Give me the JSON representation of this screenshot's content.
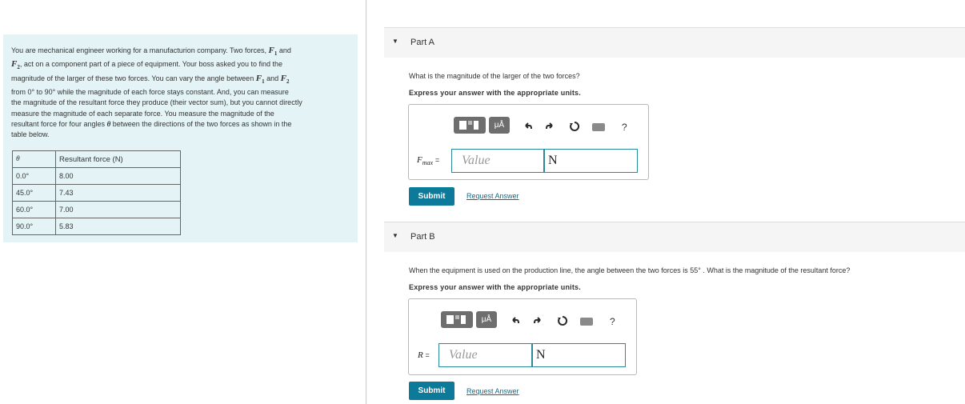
{
  "problem": {
    "line1_a": "You are mechanical engineer working for a manufacturion company. Two forces,",
    "line1_b": "and",
    "f1": "F",
    "f1_sub": "1",
    "f2": "F",
    "f2_sub": "2",
    "line2": ", act on a component part of a piece of equipment. Your boss asked you to find the",
    "line3_a": "magnitude of the larger of these two forces. You can vary the angle between",
    "line3_b": "and",
    "line4": "from 0° to 90° while the magnitude of each force stays constant. And, you can measure",
    "line5": "the magnitude of the resultant force they produce (their vector sum), but you cannot directly",
    "line6": "measure the magnitude of each separate force. You measure the magnitude of the",
    "line7_a": "resultant force for four angles",
    "line7_theta": "θ",
    "line7_b": "between the directions of the two forces as shown in the",
    "line8": "table below."
  },
  "table": {
    "header_theta": "θ",
    "header_force": "Resultant force (N)",
    "rows": [
      {
        "angle": "0.0°",
        "force": "8.00"
      },
      {
        "angle": "45.0°",
        "force": "7.43"
      },
      {
        "angle": "60.0°",
        "force": "7.00"
      },
      {
        "angle": "90.0°",
        "force": "5.83"
      }
    ]
  },
  "partA": {
    "caret": "▼",
    "title": "Part A",
    "question": "What is the magnitude of the larger of the two forces?",
    "instruction": "Express your answer with the appropriate units.",
    "var": "F",
    "var_sub": "max",
    "equals": "=",
    "placeholder": "Value",
    "unit": "N",
    "submit": "Submit",
    "request": "Request Answer"
  },
  "partB": {
    "caret": "▼",
    "title": "Part B",
    "question": "When the equipment is used on the production line, the angle between the two forces is 55° . What is the magnitude of the resultant force?",
    "instruction": "Express your answer with the appropriate units.",
    "var": "R",
    "equals": "=",
    "placeholder": "Value",
    "unit": "N",
    "submit": "Submit",
    "request": "Request Answer"
  },
  "toolbar": {
    "mu_label": "μÅ",
    "help": "?",
    "icons": [
      "templates-icon",
      "units-icon",
      "undo-icon",
      "redo-icon",
      "reset-icon",
      "keyboard-icon",
      "help-icon"
    ]
  }
}
